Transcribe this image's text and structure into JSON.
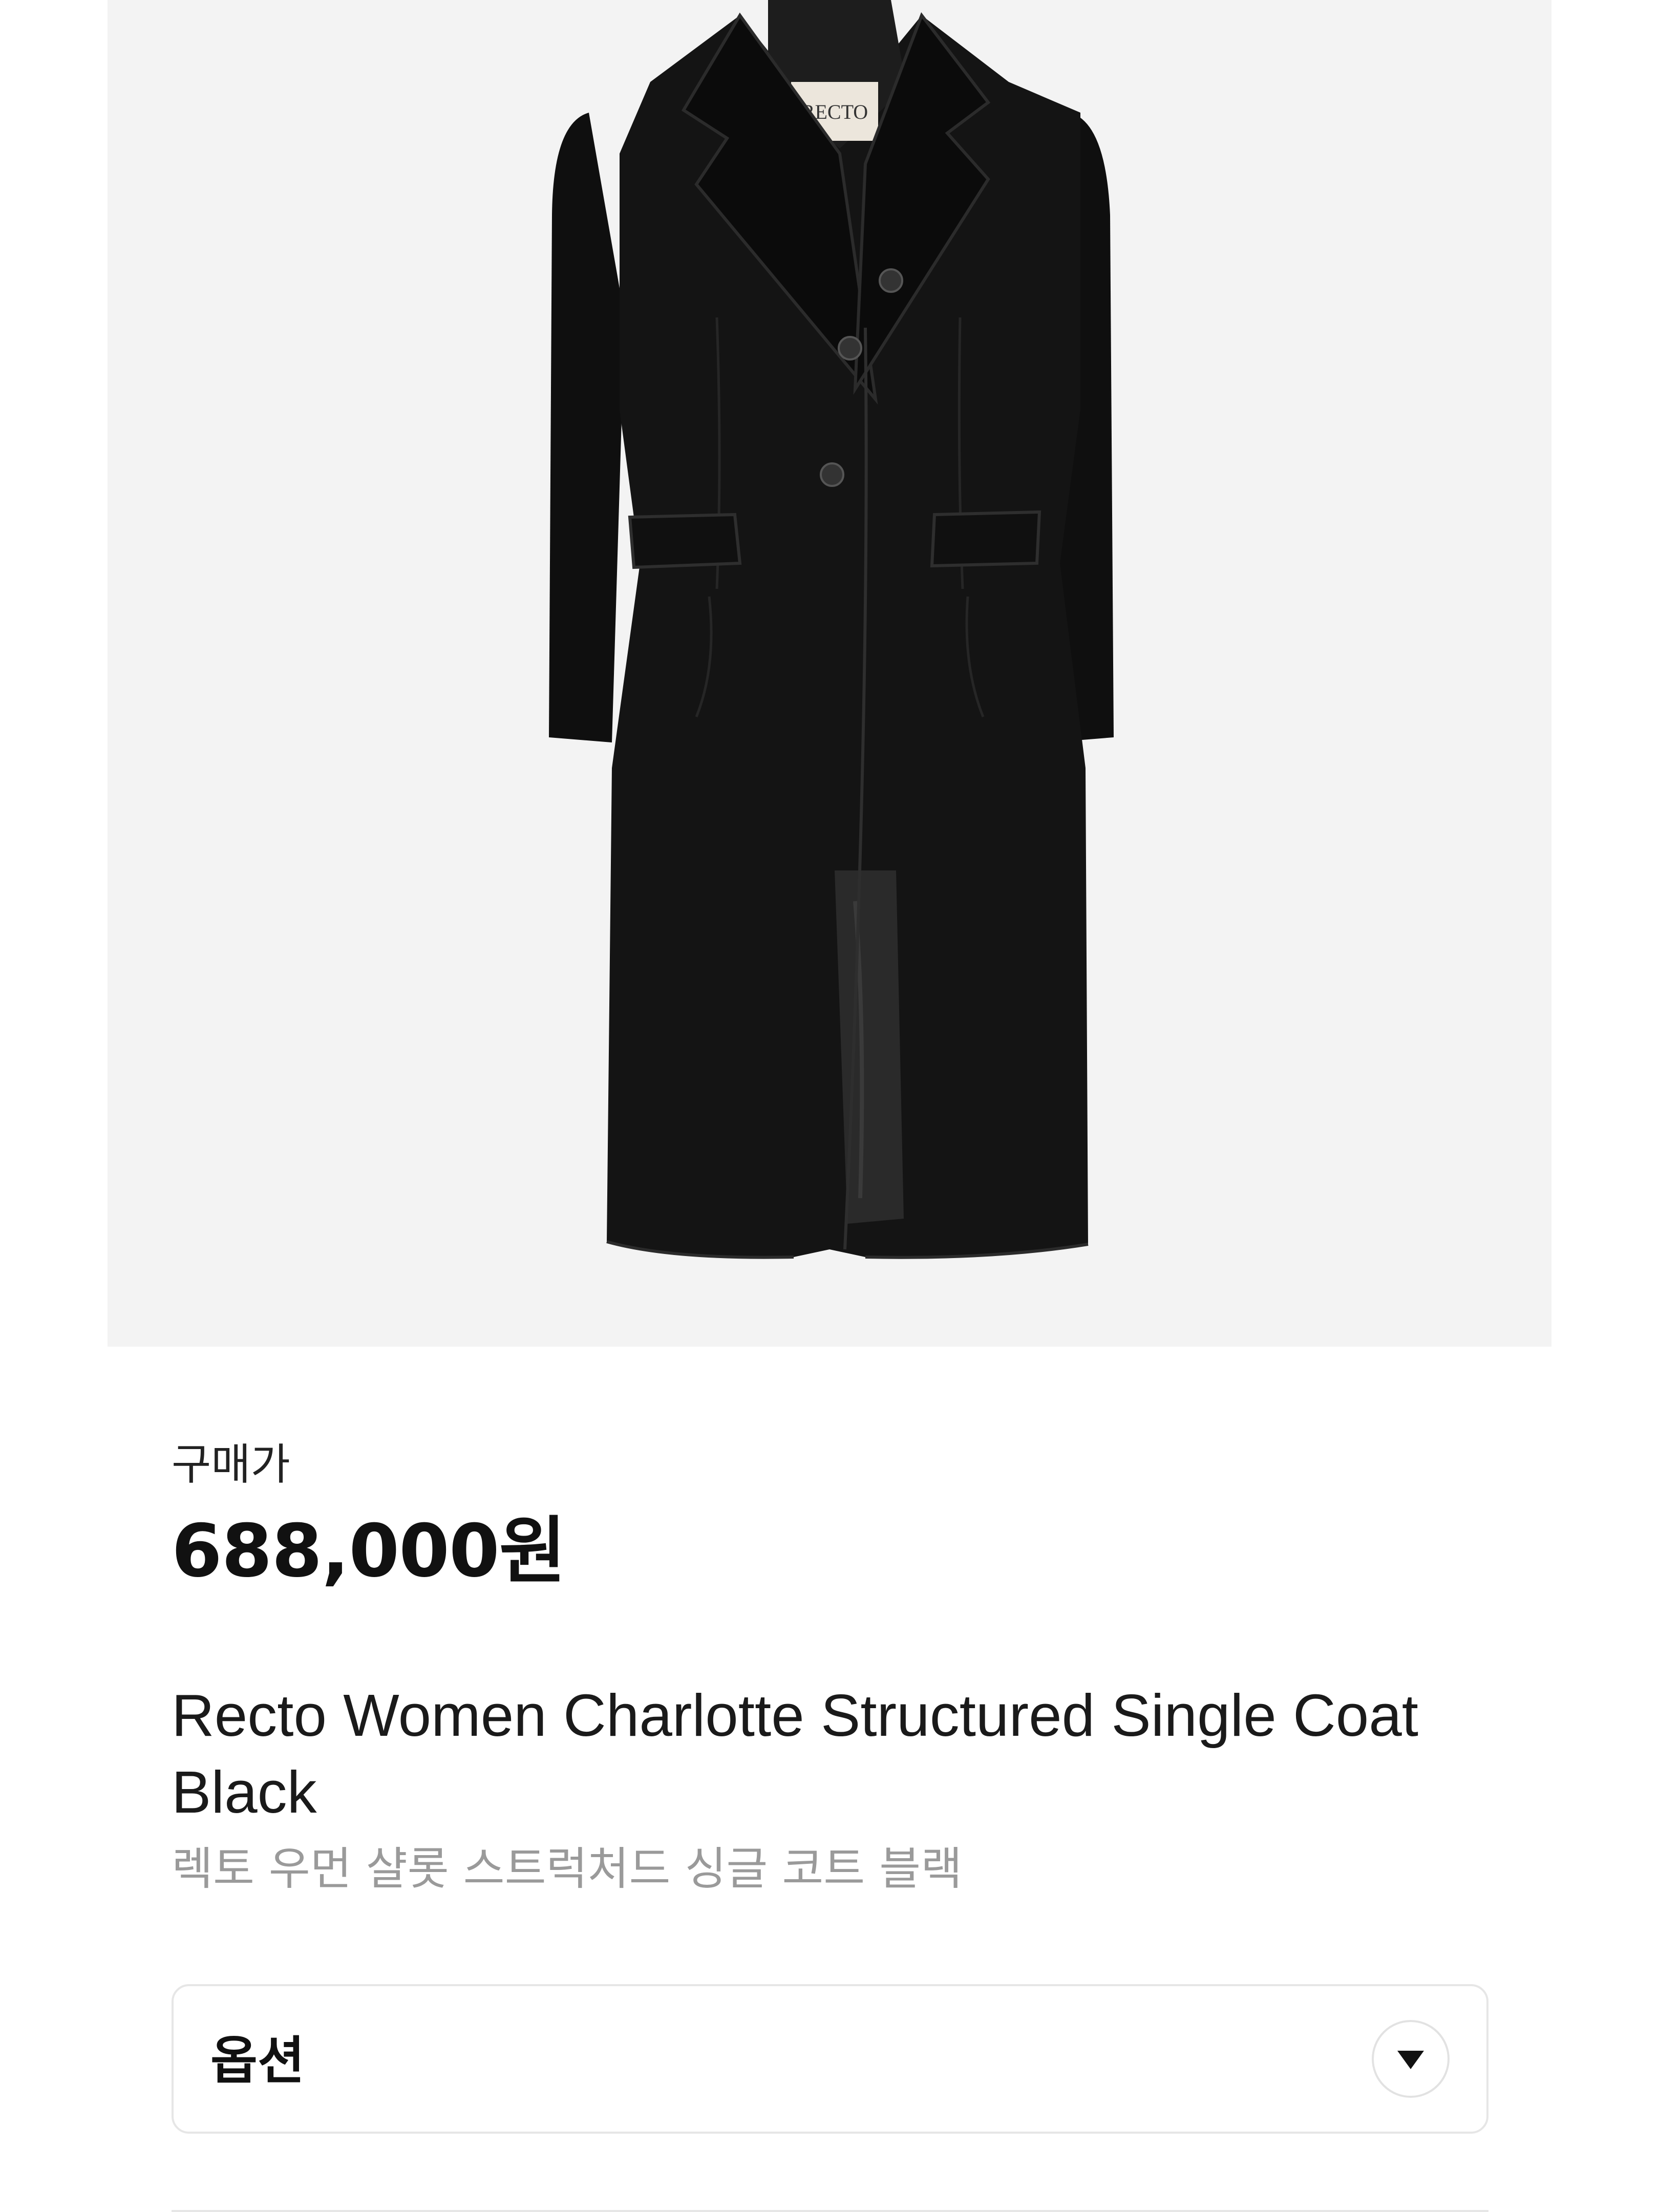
{
  "product": {
    "image_alt": "Recto Women Charlotte Structured Single Coat Black",
    "label_text": "RECTO",
    "price_label": "구매가",
    "price": "688,000원",
    "name_en": "Recto Women Charlotte Structured Single Coat Black",
    "name_ko": "렉토 우먼 샬롯 스트럭처드 싱글 코트 블랙"
  },
  "option": {
    "label": "옵션",
    "icon": "chevron-down-icon"
  },
  "colors": {
    "image_background": "#f3f3f3",
    "coat": "#121212",
    "price_text": "#111111",
    "subtitle_text": "#9a9a9a",
    "border": "#e6e6e6"
  }
}
